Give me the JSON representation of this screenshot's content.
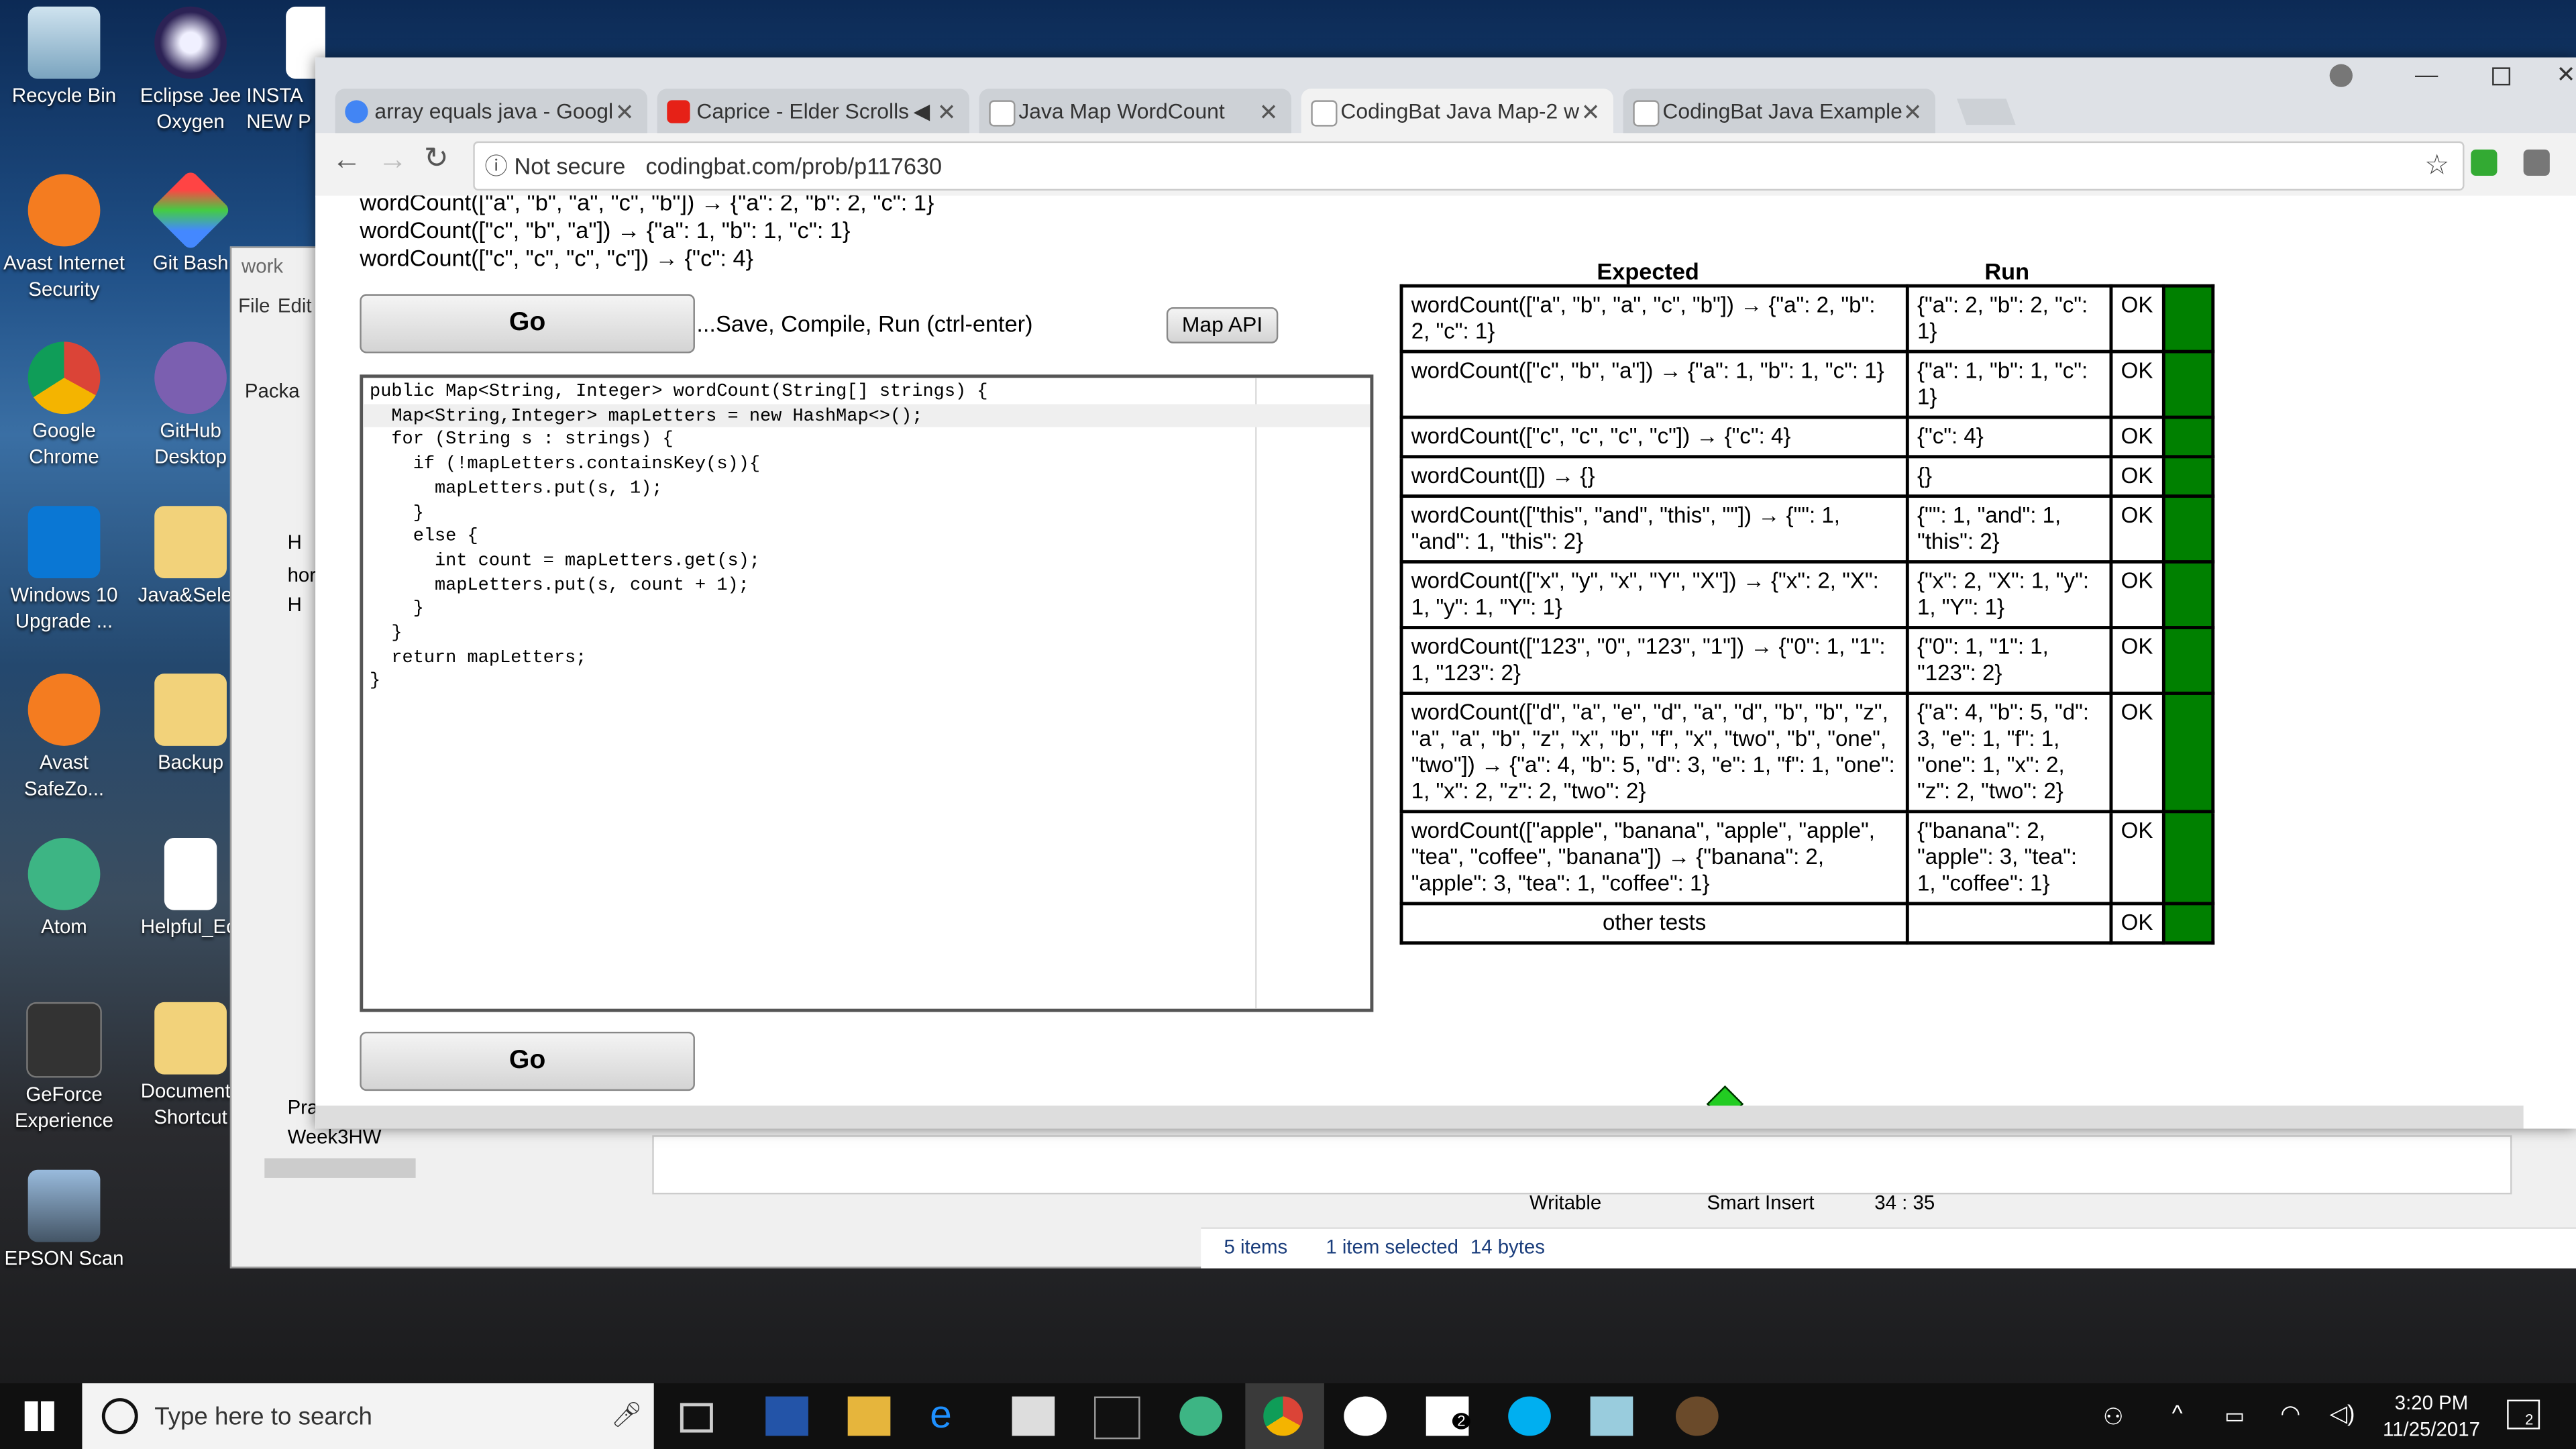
{
  "desktop": {
    "icons": [
      {
        "label": "Recycle Bin"
      },
      {
        "label": "Eclipse Jee Oxygen"
      },
      {
        "label": "INSTA NEW P"
      },
      {
        "label": "Avast Internet Security"
      },
      {
        "label": "Git Bash"
      },
      {
        "label": "Google Chrome"
      },
      {
        "label": "GitHub Desktop"
      },
      {
        "label": "Windows 10 Upgrade ..."
      },
      {
        "label": "Java&Selen"
      },
      {
        "label": "Avast SafeZo..."
      },
      {
        "label": "Backup"
      },
      {
        "label": "Atom"
      },
      {
        "label": "Helpful_Ecl"
      },
      {
        "label": "GeForce Experience"
      },
      {
        "label": "Documents Shortcut"
      },
      {
        "label": "EPSON Scan"
      }
    ]
  },
  "eclipse": {
    "title": "work",
    "menu": [
      "File",
      "Edit"
    ],
    "package_label": "Packa",
    "tree_items": [
      "H",
      "hor",
      "H",
      "Pra",
      "Week3HW"
    ],
    "status": {
      "writable": "Writable",
      "insert": "Smart Insert",
      "position": "34 : 35"
    }
  },
  "explorer_status": {
    "items": "5 items",
    "selected": "1 item selected",
    "size": "14 bytes"
  },
  "chrome": {
    "tabs": [
      {
        "title": "array equals java - Googl"
      },
      {
        "title": "Caprice - Elder Scrolls"
      },
      {
        "title": "Java Map WordCount"
      },
      {
        "title": "CodingBat Java Map-2 w"
      },
      {
        "title": "CodingBat Java Example"
      }
    ],
    "security": "Not secure",
    "url": "codingbat.com/prob/p117630"
  },
  "page": {
    "examples": [
      "wordCount([\"a\", \"b\", \"a\", \"c\", \"b\"]) → {\"a\": 2, \"b\": 2, \"c\": 1}",
      "wordCount([\"c\", \"b\", \"a\"]) → {\"a\": 1, \"b\": 1, \"c\": 1}",
      "wordCount([\"c\", \"c\", \"c\", \"c\"]) → {\"c\": 4}"
    ],
    "go_label": "Go",
    "save_hint": "...Save, Compile, Run (ctrl-enter)",
    "map_api_label": "Map API",
    "code_lines": [
      "public Map<String, Integer> wordCount(String[] strings) {",
      "  Map<String,Integer> mapLetters = new HashMap<>();",
      "  for (String s : strings) {",
      "    if (!mapLetters.containsKey(s)){",
      "      mapLetters.put(s, 1);",
      "    }",
      "    else {",
      "      int count = mapLetters.get(s);",
      "      mapLetters.put(s, count + 1);",
      "    }",
      "  }",
      "  return mapLetters;",
      "}"
    ],
    "results_header": {
      "expected": "Expected",
      "run": "Run"
    },
    "results": [
      {
        "expected": "wordCount([\"a\", \"b\", \"a\", \"c\", \"b\"]) → {\"a\": 2, \"b\": 2, \"c\": 1}",
        "run": "{\"a\": 2, \"b\": 2, \"c\": 1}",
        "status": "OK"
      },
      {
        "expected": "wordCount([\"c\", \"b\", \"a\"]) → {\"a\": 1, \"b\": 1, \"c\": 1}",
        "run": "{\"a\": 1, \"b\": 1, \"c\": 1}",
        "status": "OK"
      },
      {
        "expected": "wordCount([\"c\", \"c\", \"c\", \"c\"]) → {\"c\": 4}",
        "run": "{\"c\": 4}",
        "status": "OK"
      },
      {
        "expected": "wordCount([]) → {}",
        "run": "{}",
        "status": "OK"
      },
      {
        "expected": "wordCount([\"this\", \"and\", \"this\", \"\"]) → {\"\": 1, \"and\": 1, \"this\": 2}",
        "run": "{\"\": 1, \"and\": 1, \"this\": 2}",
        "status": "OK"
      },
      {
        "expected": "wordCount([\"x\", \"y\", \"x\", \"Y\", \"X\"]) → {\"x\": 2, \"X\": 1, \"y\": 1, \"Y\": 1}",
        "run": "{\"x\": 2, \"X\": 1, \"y\": 1, \"Y\": 1}",
        "status": "OK"
      },
      {
        "expected": "wordCount([\"123\", \"0\", \"123\", \"1\"]) → {\"0\": 1, \"1\": 1, \"123\": 2}",
        "run": "{\"0\": 1, \"1\": 1, \"123\": 2}",
        "status": "OK"
      },
      {
        "expected": "wordCount([\"d\", \"a\", \"e\", \"d\", \"a\", \"d\", \"b\", \"b\", \"z\", \"a\", \"a\", \"b\", \"z\", \"x\", \"b\", \"f\", \"x\", \"two\", \"b\", \"one\", \"two\"]) → {\"a\": 4, \"b\": 5, \"d\": 3, \"e\": 1, \"f\": 1, \"one\": 1, \"x\": 2, \"z\": 2, \"two\": 2}",
        "run": "{\"a\": 4, \"b\": 5, \"d\": 3, \"e\": 1, \"f\": 1, \"one\": 1, \"x\": 2, \"z\": 2, \"two\": 2}",
        "status": "OK"
      },
      {
        "expected": "wordCount([\"apple\", \"banana\", \"apple\", \"apple\", \"tea\", \"coffee\", \"banana\"]) → {\"banana\": 2, \"apple\": 3, \"tea\": 1, \"coffee\": 1}",
        "run": "{\"banana\": 2, \"apple\": 3, \"tea\": 1, \"coffee\": 1}",
        "status": "OK"
      },
      {
        "expected": "other tests",
        "run": "",
        "status": "OK"
      }
    ]
  },
  "taskbar": {
    "search_placeholder": "Type here to search",
    "time": "3:20 PM",
    "date": "11/25/2017",
    "mail_badge": "2",
    "notification_count": "2"
  }
}
